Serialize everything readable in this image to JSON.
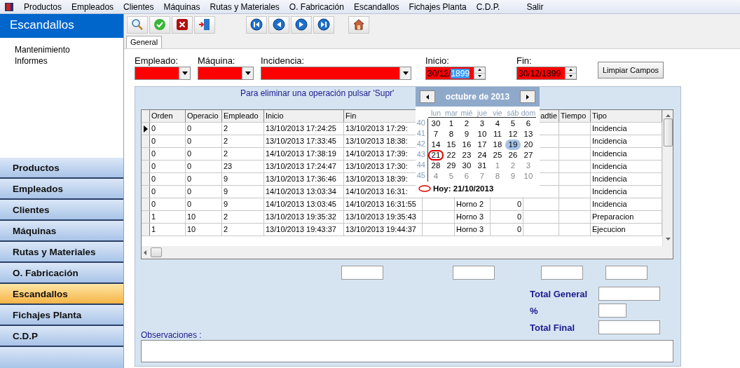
{
  "menu_bar": {
    "items": [
      "Productos",
      "Empleados",
      "Clientes",
      "Máquinas",
      "Rutas y  Materiales",
      "O. Fabricación",
      "Escandallos",
      "Fichajes Planta",
      "C.D.P.",
      "Salir"
    ]
  },
  "sidebar": {
    "title": "Escandallos",
    "links": [
      "Mantenimiento",
      "Informes"
    ],
    "nav": [
      {
        "label": "Productos",
        "selected": false
      },
      {
        "label": "Empleados",
        "selected": false
      },
      {
        "label": "Clientes",
        "selected": false
      },
      {
        "label": "Máquinas",
        "selected": false
      },
      {
        "label": "Rutas y Materiales",
        "selected": false
      },
      {
        "label": "O. Fabricación",
        "selected": false
      },
      {
        "label": "Escandallos",
        "selected": true
      },
      {
        "label": "Fichajes Planta",
        "selected": false
      },
      {
        "label": "C.D.P",
        "selected": false
      }
    ]
  },
  "tabs": [
    {
      "label": "General",
      "selected": true
    }
  ],
  "filters": {
    "combos": [
      {
        "label": "Empleado:"
      },
      {
        "label": "Máquina:"
      },
      {
        "label": "Incidencia:"
      }
    ],
    "dates": [
      {
        "label": "Inicio:",
        "parts": [
          {
            "text": "30/12/",
            "selected": false
          },
          {
            "text": "1899",
            "selected": true
          }
        ]
      },
      {
        "label": "Fin:",
        "parts": [
          {
            "text": "30/12/1899",
            "selected": false
          }
        ]
      }
    ],
    "clear_button": "Limpiar Campos"
  },
  "hint": "Para eliminar una operación pulsar 'Supr'",
  "table": {
    "columns": [
      "Orden",
      "Operacio",
      "Empleado",
      "Inicio",
      "Fin",
      "adtie",
      "Tiempo",
      "Tipo"
    ],
    "rows": [
      {
        "selected": true,
        "orden": "0",
        "operacion": "0",
        "empleado": "2",
        "inicio": "13/10/2013 17:24:25",
        "fin": "13/10/2013 17:29:",
        "tipo": "Incidencia"
      },
      {
        "selected": false,
        "orden": "0",
        "operacion": "0",
        "empleado": "2",
        "inicio": "13/10/2013 17:33:45",
        "fin": "13/10/2013 18:38:",
        "tipo": "Incidencia"
      },
      {
        "selected": false,
        "orden": "0",
        "operacion": "0",
        "empleado": "2",
        "inicio": "14/10/2013 17:38:19",
        "fin": "14/10/2013 17:39:",
        "tipo": "Incidencia"
      },
      {
        "selected": false,
        "orden": "0",
        "operacion": "0",
        "empleado": "23",
        "inicio": "13/10/2013 17:24:47",
        "fin": "13/10/2013 17:30:",
        "tipo": "Incidencia"
      },
      {
        "selected": false,
        "orden": "0",
        "operacion": "0",
        "empleado": "9",
        "inicio": "13/10/2013 17:36:46",
        "fin": "13/10/2013 18:39:",
        "tipo": "Incidencia"
      },
      {
        "selected": false,
        "orden": "0",
        "operacion": "0",
        "empleado": "9",
        "inicio": "14/10/2013 13:03:34",
        "fin": "14/10/2013 16:31:",
        "tipo": "Incidencia"
      },
      {
        "selected": false,
        "orden": "0",
        "operacion": "0",
        "empleado": "9",
        "inicio": "14/10/2013 13:03:45",
        "fin": "14/10/2013 16:31:55",
        "column_8": "Horno 2",
        "column_9": "0",
        "tipo": "Incidencia"
      },
      {
        "selected": false,
        "orden": "1",
        "operacion": "10",
        "empleado": "2",
        "inicio": "13/10/2013 19:35:32",
        "fin": "13/10/2013 19:35:43",
        "column_8": "Horno 3",
        "column_9": "0",
        "tipo": "Preparacion"
      },
      {
        "selected": false,
        "orden": "1",
        "operacion": "10",
        "empleado": "2",
        "inicio": "13/10/2013 19:43:37",
        "fin": "13/10/2013 19:44:37",
        "column_8": "Horno 3",
        "column_9": "0",
        "tipo": "Ejecucion"
      }
    ]
  },
  "calendar": {
    "month": "octubre de 2013",
    "weekdays": [
      "lun",
      "mar",
      "mié",
      "jue",
      "vie",
      "sáb",
      "dom"
    ],
    "weeks": [
      {
        "number": "40",
        "days": [
          {
            "label": "30",
            "muted": false,
            "selected": false,
            "today": false
          },
          {
            "label": "1",
            "muted": false,
            "selected": false,
            "today": false
          },
          {
            "label": "2",
            "muted": false,
            "selected": false,
            "today": false
          },
          {
            "label": "3",
            "muted": false,
            "selected": false,
            "today": false
          },
          {
            "label": "4",
            "muted": false,
            "selected": false,
            "today": false
          },
          {
            "label": "5",
            "muted": false,
            "selected": false,
            "today": false
          },
          {
            "label": "6",
            "muted": false,
            "selected": false,
            "today": false
          }
        ]
      },
      {
        "number": "41",
        "days": [
          {
            "label": "7",
            "muted": false,
            "selected": false,
            "today": false
          },
          {
            "label": "8",
            "muted": false,
            "selected": false,
            "today": false
          },
          {
            "label": "9",
            "muted": false,
            "selected": false,
            "today": false
          },
          {
            "label": "10",
            "muted": false,
            "selected": false,
            "today": false
          },
          {
            "label": "11",
            "muted": false,
            "selected": false,
            "today": false
          },
          {
            "label": "12",
            "muted": false,
            "selected": false,
            "today": false
          },
          {
            "label": "13",
            "muted": false,
            "selected": false,
            "today": false
          }
        ]
      },
      {
        "number": "42",
        "days": [
          {
            "label": "14",
            "muted": false,
            "selected": false,
            "today": false
          },
          {
            "label": "15",
            "muted": false,
            "selected": false,
            "today": false
          },
          {
            "label": "16",
            "muted": false,
            "selected": false,
            "today": false
          },
          {
            "label": "17",
            "muted": false,
            "selected": false,
            "today": false
          },
          {
            "label": "18",
            "muted": false,
            "selected": false,
            "today": false
          },
          {
            "label": "19",
            "muted": false,
            "selected": true,
            "today": false
          },
          {
            "label": "20",
            "muted": false,
            "selected": false,
            "today": false
          }
        ]
      },
      {
        "number": "43",
        "days": [
          {
            "label": "21",
            "muted": false,
            "selected": false,
            "today": true
          },
          {
            "label": "22",
            "muted": false,
            "selected": false,
            "today": false
          },
          {
            "label": "23",
            "muted": false,
            "selected": false,
            "today": false
          },
          {
            "label": "24",
            "muted": false,
            "selected": false,
            "today": false
          },
          {
            "label": "25",
            "muted": false,
            "selected": false,
            "today": false
          },
          {
            "label": "26",
            "muted": false,
            "selected": false,
            "today": false
          },
          {
            "label": "27",
            "muted": false,
            "selected": false,
            "today": false
          }
        ]
      },
      {
        "number": "44",
        "days": [
          {
            "label": "28",
            "muted": false,
            "selected": false,
            "today": false
          },
          {
            "label": "29",
            "muted": false,
            "selected": false,
            "today": false
          },
          {
            "label": "30",
            "muted": false,
            "selected": false,
            "today": false
          },
          {
            "label": "31",
            "muted": false,
            "selected": false,
            "today": false
          },
          {
            "label": "1",
            "muted": true,
            "selected": false,
            "today": false
          },
          {
            "label": "2",
            "muted": true,
            "selected": false,
            "today": false
          },
          {
            "label": "3",
            "muted": true,
            "selected": false,
            "today": false
          }
        ]
      },
      {
        "number": "45",
        "days": [
          {
            "label": "4",
            "muted": true,
            "selected": false,
            "today": false
          },
          {
            "label": "5",
            "muted": true,
            "selected": false,
            "today": false
          },
          {
            "label": "6",
            "muted": true,
            "selected": false,
            "today": false
          },
          {
            "label": "7",
            "muted": true,
            "selected": false,
            "today": false
          },
          {
            "label": "8",
            "muted": true,
            "selected": false,
            "today": false
          },
          {
            "label": "9",
            "muted": true,
            "selected": false,
            "today": false
          },
          {
            "label": "10",
            "muted": true,
            "selected": false,
            "today": false
          }
        ]
      }
    ],
    "today_label": "Hoy: 21/10/2013"
  },
  "totals": {
    "labels": [
      "Total General",
      "%",
      "Total Final"
    ]
  },
  "observations": {
    "label": "Observaciones :"
  }
}
